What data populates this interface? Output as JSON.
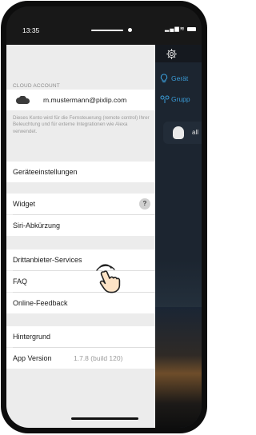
{
  "status_bar": {
    "time": "13:35"
  },
  "header": {
    "settings_icon": "gear-icon"
  },
  "cloud_account": {
    "section_label": "CLOUD ACCOUNT",
    "email": "m.mustermann@pixlip.com",
    "description": "Dieses Konto wird für die Fernsteuerung (remote control) Ihrer Beleuchtung und für externe Integrationen wie Alexa verwendet."
  },
  "settings": {
    "device_settings": "Geräteeinstellungen",
    "widget": "Widget",
    "widget_help": "?",
    "siri_shortcut": "Siri-Abkürzung",
    "third_party": "Drittanbieter-Services",
    "faq": "FAQ",
    "feedback": "Online-Feedback",
    "background": "Hintergrund",
    "app_version_label": "App Version",
    "app_version_value": "1.7.8 (build 120)"
  },
  "right_panel": {
    "devices_label": "Gerät",
    "groups_label": "Grupp",
    "tile_label": "all"
  },
  "colors": {
    "accent": "#3a9bd6",
    "panel_bg": "#ececec",
    "dark_bg": "#1c2530"
  }
}
